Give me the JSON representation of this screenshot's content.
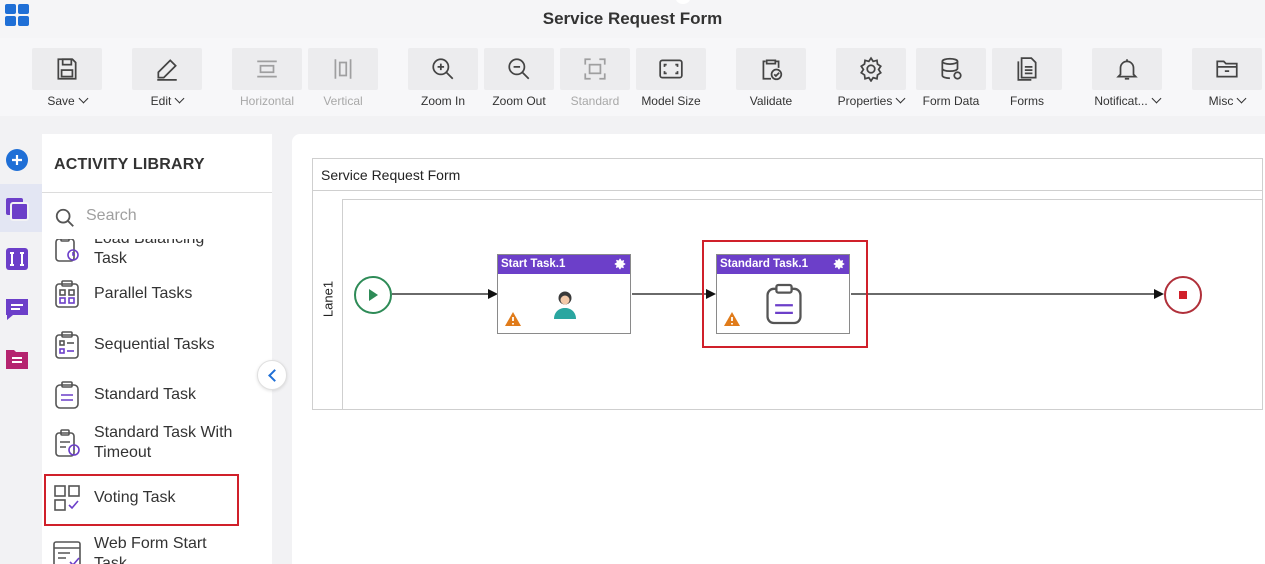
{
  "header": {
    "title": "Service Request Form"
  },
  "colors": {
    "accent": "#1f6fd6",
    "task_header": "#6c3fc9",
    "start_event": "#2e8b57",
    "end_event": "#b0303a",
    "highlight": "#d0202a",
    "warning": "#e07b1a"
  },
  "toolbar": {
    "items": [
      {
        "label": "Save",
        "icon": "save-icon",
        "dropdown": true,
        "enabled": true
      },
      {
        "label": "Edit",
        "icon": "pencil-icon",
        "dropdown": true,
        "enabled": true
      },
      {
        "label": "Horizontal",
        "icon": "align-horizontal-icon",
        "dropdown": false,
        "enabled": false
      },
      {
        "label": "Vertical",
        "icon": "align-vertical-icon",
        "dropdown": false,
        "enabled": false
      },
      {
        "label": "Zoom In",
        "icon": "zoom-in-icon",
        "dropdown": false,
        "enabled": true
      },
      {
        "label": "Zoom Out",
        "icon": "zoom-out-icon",
        "dropdown": false,
        "enabled": true
      },
      {
        "label": "Standard",
        "icon": "standard-size-icon",
        "dropdown": false,
        "enabled": false
      },
      {
        "label": "Model Size",
        "icon": "model-size-icon",
        "dropdown": false,
        "enabled": true
      },
      {
        "label": "Validate",
        "icon": "validate-icon",
        "dropdown": false,
        "enabled": true
      },
      {
        "label": "Properties",
        "icon": "gear-icon",
        "dropdown": true,
        "enabled": true
      },
      {
        "label": "Form Data",
        "icon": "database-icon",
        "dropdown": false,
        "enabled": true
      },
      {
        "label": "Forms",
        "icon": "forms-icon",
        "dropdown": false,
        "enabled": true
      },
      {
        "label": "Notificat...",
        "icon": "bell-icon",
        "dropdown": true,
        "enabled": true
      },
      {
        "label": "Misc",
        "icon": "folder-icon",
        "dropdown": true,
        "enabled": true
      }
    ]
  },
  "rail": {
    "items": [
      {
        "icon": "add-circle-icon",
        "active": false
      },
      {
        "icon": "activity-library-icon",
        "active": true
      },
      {
        "icon": "variables-icon",
        "active": false
      },
      {
        "icon": "comments-icon",
        "active": false
      },
      {
        "icon": "documents-icon",
        "active": false
      }
    ]
  },
  "library": {
    "title": "ACTIVITY LIBRARY",
    "search_placeholder": "Search",
    "items": [
      {
        "label": "Load Balancing Task",
        "icon": "load-balancing-task-icon"
      },
      {
        "label": "Parallel Tasks",
        "icon": "parallel-tasks-icon"
      },
      {
        "label": "Sequential Tasks",
        "icon": "sequential-tasks-icon"
      },
      {
        "label": "Standard Task",
        "icon": "standard-task-icon",
        "highlighted": true
      },
      {
        "label": "Standard Task With Timeout",
        "icon": "standard-task-timeout-icon"
      },
      {
        "label": "Voting Task",
        "icon": "voting-task-icon"
      },
      {
        "label": "Web Form Start Task",
        "icon": "web-form-start-task-icon"
      }
    ]
  },
  "canvas": {
    "pool_title": "Service Request Form",
    "lane_label": "Lane1",
    "tasks": [
      {
        "name": "Start Task.1",
        "icon": "user-icon",
        "warning": true
      },
      {
        "name": "Standard Task.1",
        "icon": "standard-task-icon",
        "warning": true,
        "highlighted": true
      }
    ],
    "start_event": "start-event-icon",
    "end_event": "end-event-icon"
  }
}
